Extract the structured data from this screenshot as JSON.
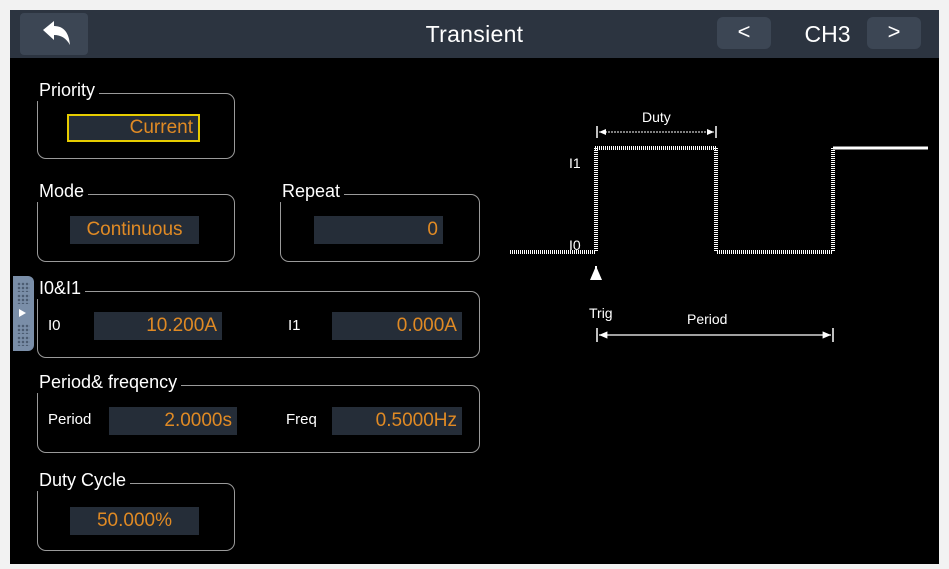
{
  "header": {
    "title": "Transient",
    "channel": "CH3",
    "prev_label": "<",
    "next_label": ">"
  },
  "priority": {
    "legend": "Priority",
    "value": "Current"
  },
  "mode": {
    "legend": "Mode",
    "value": "Continuous"
  },
  "repeat": {
    "legend": "Repeat",
    "value": "0"
  },
  "levels": {
    "legend": "I0&I1",
    "i0_label": "I0",
    "i0_value": "10.200A",
    "i1_label": "I1",
    "i1_value": "0.000A"
  },
  "period_freq": {
    "legend": "Period& freqency",
    "period_label": "Period",
    "period_value": "2.0000s",
    "freq_label": "Freq",
    "freq_value": "0.5000Hz"
  },
  "duty": {
    "legend": "Duty Cycle",
    "value": "50.000%"
  },
  "diagram": {
    "duty_label": "Duty",
    "i1_label": "I1",
    "i0_label": "I0",
    "trig_label": "Trig",
    "period_label": "Period"
  },
  "colors": {
    "background": "#000000",
    "titlebar": "#2c3440",
    "field_bg": "#252d38",
    "value_text": "#e08a24",
    "selection": "#e6cc00"
  },
  "icons": {
    "back": "back-arrow-icon",
    "prev": "chevron-left-icon",
    "next": "chevron-right-icon",
    "side_tab": "expand-panel-icon"
  }
}
